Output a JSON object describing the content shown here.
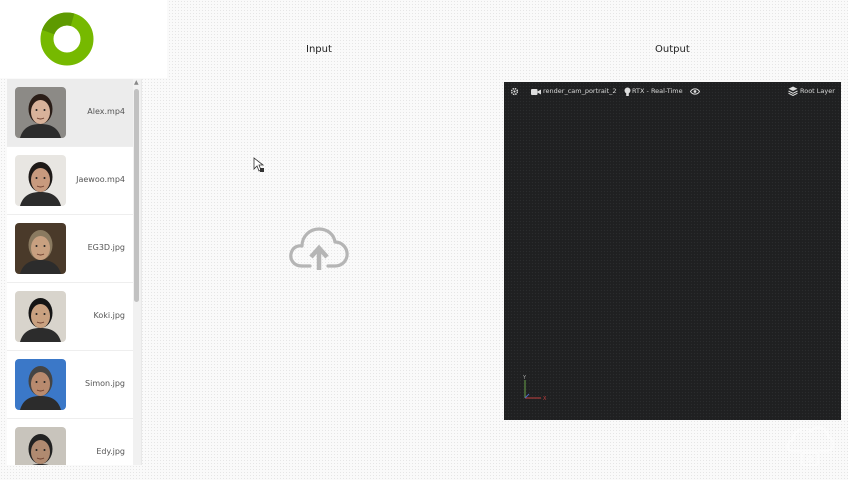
{
  "titles": {
    "input": "Input",
    "output": "Output"
  },
  "files": [
    {
      "label": "Alex.mp4",
      "selected": true,
      "skin": "#d8b29a",
      "hair": "#2a1d17",
      "bg": "#8c8a86"
    },
    {
      "label": "Jaewoo.mp4",
      "selected": false,
      "skin": "#c89a7e",
      "hair": "#1e1a18",
      "bg": "#e8e6e2"
    },
    {
      "label": "EG3D.jpg",
      "selected": false,
      "skin": "#c8a080",
      "hair": "#8a7a60",
      "bg": "#4a3a2a"
    },
    {
      "label": "Koki.jpg",
      "selected": false,
      "skin": "#c9a180",
      "hair": "#151515",
      "bg": "#d8d4cc"
    },
    {
      "label": "Simon.jpg",
      "selected": false,
      "skin": "#b88a6e",
      "hair": "#444",
      "bg": "#3b78c8"
    },
    {
      "label": "Edy.jpg",
      "selected": false,
      "skin": "#b08a70",
      "hair": "#222",
      "bg": "#c8c4bc"
    }
  ],
  "viewport": {
    "settings_icon": "gear-icon",
    "camera_icon": "video-camera-icon",
    "camera_name": "render_cam_portrait_2",
    "renderer_icon": "lightbulb-icon",
    "renderer": "RTX - Real-Time",
    "visibility_icon": "eye-icon",
    "layer_icon": "layers-icon",
    "layer": "Root Layer",
    "axis_y": "Y",
    "axis_x": "X"
  },
  "colors": {
    "brand_green": "#76b900",
    "viewport_bg": "#1f2021"
  }
}
